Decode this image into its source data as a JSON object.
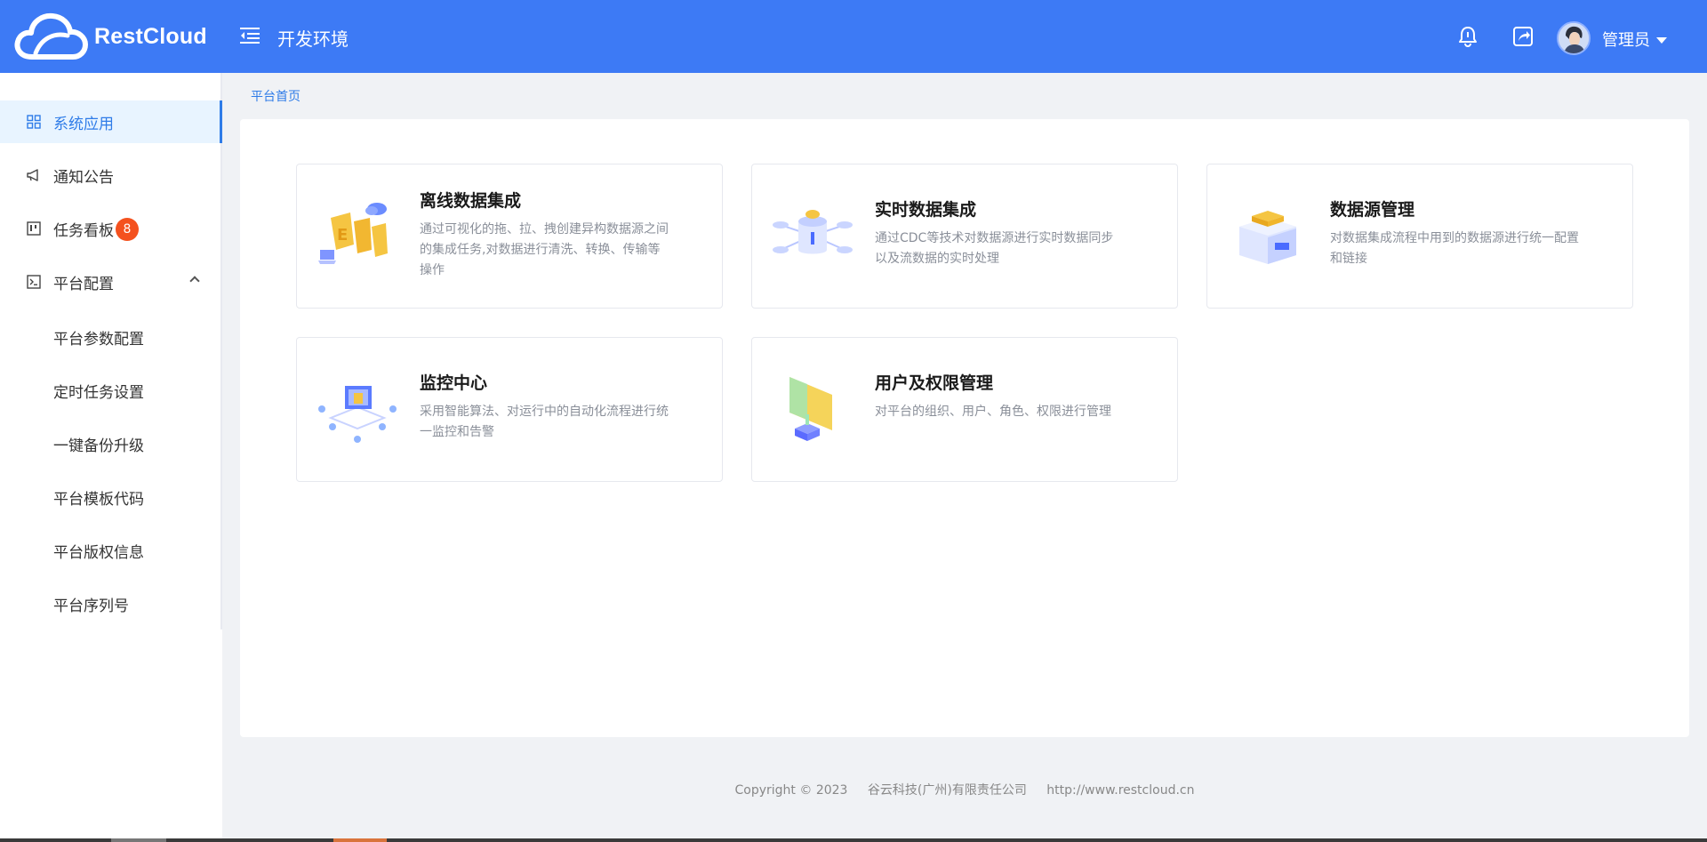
{
  "header": {
    "logo_text": "RestCloud",
    "env_title": "开发环境",
    "user_name": "管理员",
    "accent_color": "#3d7af5",
    "icons": [
      "menu-fold-icon",
      "bell-icon",
      "share-icon",
      "avatar",
      "caret-down-icon"
    ]
  },
  "sidebar": {
    "items": [
      {
        "label": "系统应用",
        "icon": "grid-icon",
        "active": true
      },
      {
        "label": "通知公告",
        "icon": "megaphone-icon"
      },
      {
        "label": "任务看板",
        "icon": "kanban-icon",
        "badge": "8"
      },
      {
        "label": "平台配置",
        "icon": "terminal-icon",
        "expanded": true
      }
    ],
    "sub_items": [
      "平台参数配置",
      "定时任务设置",
      "一键备份升级",
      "平台模板代码",
      "平台版权信息",
      "平台序列号"
    ]
  },
  "breadcrumb": "平台首页",
  "cards": [
    {
      "title": "离线数据集成",
      "desc": "通过可视化的拖、拉、拽创建异构数据源之间的集成任务,对数据进行清洗、转换、传输等操作"
    },
    {
      "title": "实时数据集成",
      "desc": "通过CDC等技术对数据源进行实时数据同步以及流数据的实时处理"
    },
    {
      "title": "数据源管理",
      "desc": "对数据集成流程中用到的数据源进行统一配置和链接"
    },
    {
      "title": "监控中心",
      "desc": "采用智能算法、对运行中的自动化流程进行统一监控和告警"
    },
    {
      "title": "用户及权限管理",
      "desc": "对平台的组织、用户、角色、权限进行管理"
    }
  ],
  "footer": {
    "copyright": "Copyright © 2023",
    "company": "谷云科技(广州)有限责任公司",
    "url": "http://www.restcloud.cn"
  }
}
